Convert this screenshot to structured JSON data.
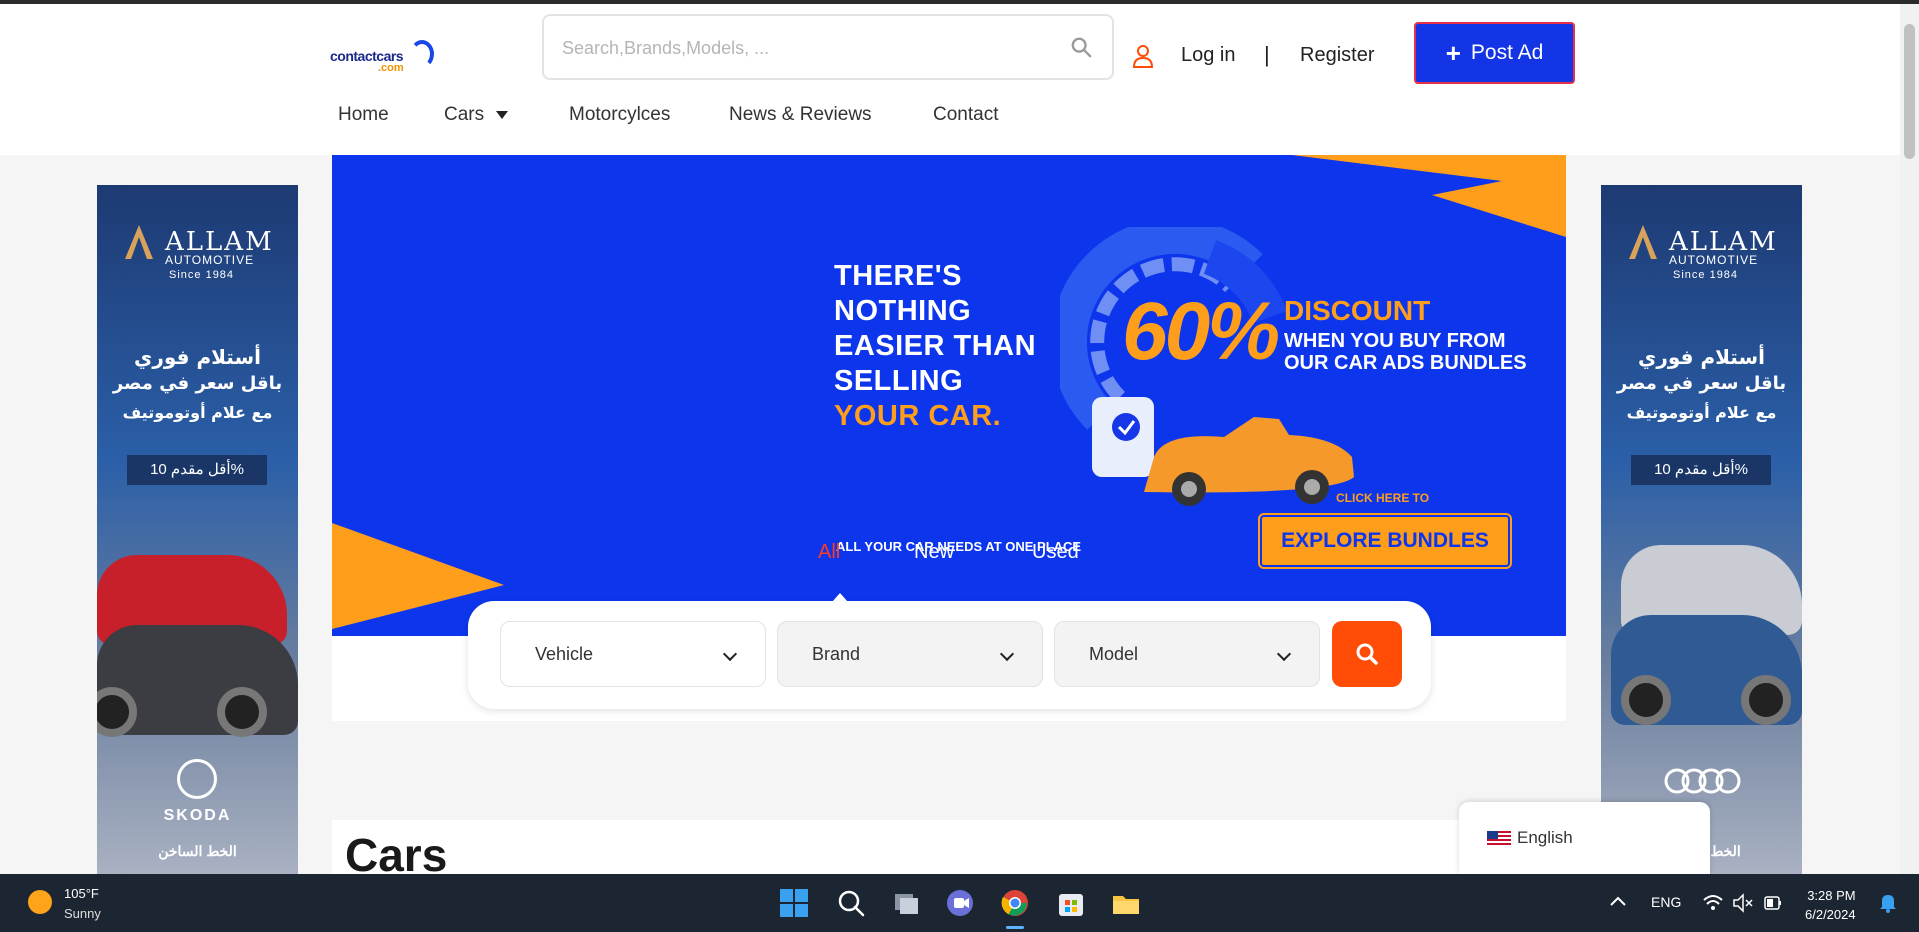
{
  "header": {
    "logo_text": "contactcars",
    "logo_domain": ".com",
    "search_placeholder": "Search,Brands,Models, ...",
    "login": "Log in",
    "separator": "|",
    "register": "Register",
    "post_ad": "Post Ad"
  },
  "nav": {
    "home": "Home",
    "cars": "Cars",
    "motorcycles": "Motorcylces",
    "news": "News & Reviews",
    "contact": "Contact"
  },
  "side_banner": {
    "brand": "ALLAM",
    "sub": "AUTOMOTIVE",
    "since": "Since 1984",
    "line1": "أستلام فوري",
    "line2": "باقل سعر في مصر",
    "line3": "مع علام أوتوموتيف",
    "badge": "أقل مقدم 10%",
    "left_car_brand": "SKODA",
    "hotline": "الخط الساخن"
  },
  "hero": {
    "title_line1": "THERE'S",
    "title_line2": "NOTHING",
    "title_line3": "EASIER THAN",
    "title_line4": "SELLING",
    "title_line5": "YOUR CAR.",
    "percent": "60%",
    "discount": "DISCOUNT",
    "when1": "WHEN YOU BUY FROM",
    "when2": "OUR CAR ADS BUNDLES",
    "click_here": "CLICK HERE TO",
    "explore": "EXPLORE BUNDLES",
    "all_needs": "ALL YOUR  CAR NEEDS AT ONE PLACE"
  },
  "tabs": {
    "all": "All",
    "new": "New",
    "used": "Used"
  },
  "search_panel": {
    "vehicle": "Vehicle",
    "brand": "Brand",
    "model": "Model"
  },
  "section": {
    "cars_title": "Cars"
  },
  "language": {
    "current": "English"
  },
  "taskbar": {
    "temp": "105°F",
    "condition": "Sunny",
    "lang": "ENG",
    "time": "3:28 PM",
    "date": "6/2/2024"
  },
  "colors": {
    "brand_blue": "#0d36ec",
    "accent_orange": "#ff9e1a",
    "search_orange": "#ff4d08"
  }
}
